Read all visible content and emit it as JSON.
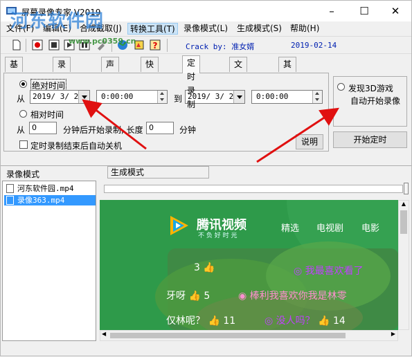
{
  "window": {
    "title": "屏幕录像专家 V2019",
    "controls": [
      "–",
      "☐",
      "✕"
    ]
  },
  "watermark": {
    "text": "河东软件园",
    "url": "www.pc0359.cn"
  },
  "menu": [
    "文件(F)",
    "编辑(E)",
    "合成截取(J)",
    "转换工具(T)",
    "录像模式(L)",
    "生成模式(S)",
    "帮助(H)"
  ],
  "toolbar": {
    "crack_text": "Crack by: 准女婿",
    "date": "2019-02-14"
  },
  "tabs": [
    "基本设置",
    "录制目标",
    "声音",
    "快捷键",
    "定时录制",
    "文件分割",
    "其它设置"
  ],
  "timer": {
    "absolute_label": "绝对时间",
    "from_label": "从",
    "start_date": "2019/ 3/ 2",
    "start_time": "0:00:00",
    "to_label": "到",
    "end_date": "2019/ 3/ 2",
    "end_time": "0:00:00",
    "relative_label": "相对时间",
    "rel_from_label": "从",
    "rel_start": "0",
    "rel_mid_label": "分钟后开始录制, 长度",
    "rel_length": "0",
    "rel_unit": "分钟",
    "shutdown_label": "定时录制结束后自动关机",
    "help_button": "说明"
  },
  "right_panel": {
    "game3d_line1": "发现3D游戏",
    "game3d_line2": "自动开始录像",
    "start_button": "开始定时"
  },
  "sections": {
    "record_mode": "录像模式",
    "generate_mode": "生成模式"
  },
  "files": [
    {
      "name": "河东软件园.mp4",
      "selected": false
    },
    {
      "name": "录像363.mp4",
      "selected": true
    }
  ],
  "preview": {
    "brand": "腾讯视频",
    "slogan": "不 负 好 时 光",
    "nav": [
      "精选",
      "电视剧",
      "电影"
    ],
    "danmaku": [
      {
        "text": "3",
        "emoji": "👍"
      },
      {
        "text": "我最喜欢看了",
        "emoji": "💬"
      },
      {
        "text": "牙呀",
        "count": "5"
      },
      {
        "text": "棒利我喜欢你我是林零"
      },
      {
        "text": "仅林呢？",
        "count": "11"
      },
      {
        "text": "没人吗？",
        "count": "14"
      }
    ]
  },
  "colors": {
    "accent": "#3399ff",
    "preview_bg": "#2e9a4a",
    "toolbar_text": "#0020b0",
    "danmaku_pink": "#ff8fd0",
    "danmaku_purple": "#c040ff"
  }
}
